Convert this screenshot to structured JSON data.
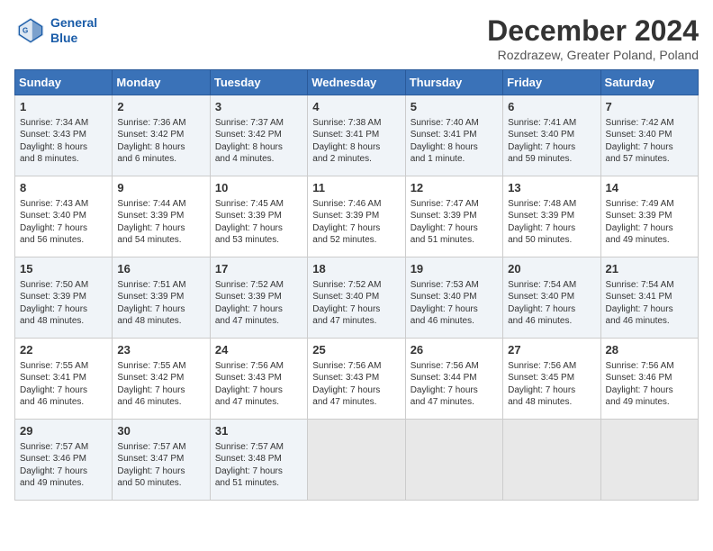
{
  "header": {
    "logo_line1": "General",
    "logo_line2": "Blue",
    "month_title": "December 2024",
    "location": "Rozdrazew, Greater Poland, Poland"
  },
  "weekdays": [
    "Sunday",
    "Monday",
    "Tuesday",
    "Wednesday",
    "Thursday",
    "Friday",
    "Saturday"
  ],
  "weeks": [
    [
      {
        "day": "1",
        "info": "Sunrise: 7:34 AM\nSunset: 3:43 PM\nDaylight: 8 hours\nand 8 minutes."
      },
      {
        "day": "2",
        "info": "Sunrise: 7:36 AM\nSunset: 3:42 PM\nDaylight: 8 hours\nand 6 minutes."
      },
      {
        "day": "3",
        "info": "Sunrise: 7:37 AM\nSunset: 3:42 PM\nDaylight: 8 hours\nand 4 minutes."
      },
      {
        "day": "4",
        "info": "Sunrise: 7:38 AM\nSunset: 3:41 PM\nDaylight: 8 hours\nand 2 minutes."
      },
      {
        "day": "5",
        "info": "Sunrise: 7:40 AM\nSunset: 3:41 PM\nDaylight: 8 hours\nand 1 minute."
      },
      {
        "day": "6",
        "info": "Sunrise: 7:41 AM\nSunset: 3:40 PM\nDaylight: 7 hours\nand 59 minutes."
      },
      {
        "day": "7",
        "info": "Sunrise: 7:42 AM\nSunset: 3:40 PM\nDaylight: 7 hours\nand 57 minutes."
      }
    ],
    [
      {
        "day": "8",
        "info": "Sunrise: 7:43 AM\nSunset: 3:40 PM\nDaylight: 7 hours\nand 56 minutes."
      },
      {
        "day": "9",
        "info": "Sunrise: 7:44 AM\nSunset: 3:39 PM\nDaylight: 7 hours\nand 54 minutes."
      },
      {
        "day": "10",
        "info": "Sunrise: 7:45 AM\nSunset: 3:39 PM\nDaylight: 7 hours\nand 53 minutes."
      },
      {
        "day": "11",
        "info": "Sunrise: 7:46 AM\nSunset: 3:39 PM\nDaylight: 7 hours\nand 52 minutes."
      },
      {
        "day": "12",
        "info": "Sunrise: 7:47 AM\nSunset: 3:39 PM\nDaylight: 7 hours\nand 51 minutes."
      },
      {
        "day": "13",
        "info": "Sunrise: 7:48 AM\nSunset: 3:39 PM\nDaylight: 7 hours\nand 50 minutes."
      },
      {
        "day": "14",
        "info": "Sunrise: 7:49 AM\nSunset: 3:39 PM\nDaylight: 7 hours\nand 49 minutes."
      }
    ],
    [
      {
        "day": "15",
        "info": "Sunrise: 7:50 AM\nSunset: 3:39 PM\nDaylight: 7 hours\nand 48 minutes."
      },
      {
        "day": "16",
        "info": "Sunrise: 7:51 AM\nSunset: 3:39 PM\nDaylight: 7 hours\nand 48 minutes."
      },
      {
        "day": "17",
        "info": "Sunrise: 7:52 AM\nSunset: 3:39 PM\nDaylight: 7 hours\nand 47 minutes."
      },
      {
        "day": "18",
        "info": "Sunrise: 7:52 AM\nSunset: 3:40 PM\nDaylight: 7 hours\nand 47 minutes."
      },
      {
        "day": "19",
        "info": "Sunrise: 7:53 AM\nSunset: 3:40 PM\nDaylight: 7 hours\nand 46 minutes."
      },
      {
        "day": "20",
        "info": "Sunrise: 7:54 AM\nSunset: 3:40 PM\nDaylight: 7 hours\nand 46 minutes."
      },
      {
        "day": "21",
        "info": "Sunrise: 7:54 AM\nSunset: 3:41 PM\nDaylight: 7 hours\nand 46 minutes."
      }
    ],
    [
      {
        "day": "22",
        "info": "Sunrise: 7:55 AM\nSunset: 3:41 PM\nDaylight: 7 hours\nand 46 minutes."
      },
      {
        "day": "23",
        "info": "Sunrise: 7:55 AM\nSunset: 3:42 PM\nDaylight: 7 hours\nand 46 minutes."
      },
      {
        "day": "24",
        "info": "Sunrise: 7:56 AM\nSunset: 3:43 PM\nDaylight: 7 hours\nand 47 minutes."
      },
      {
        "day": "25",
        "info": "Sunrise: 7:56 AM\nSunset: 3:43 PM\nDaylight: 7 hours\nand 47 minutes."
      },
      {
        "day": "26",
        "info": "Sunrise: 7:56 AM\nSunset: 3:44 PM\nDaylight: 7 hours\nand 47 minutes."
      },
      {
        "day": "27",
        "info": "Sunrise: 7:56 AM\nSunset: 3:45 PM\nDaylight: 7 hours\nand 48 minutes."
      },
      {
        "day": "28",
        "info": "Sunrise: 7:56 AM\nSunset: 3:46 PM\nDaylight: 7 hours\nand 49 minutes."
      }
    ],
    [
      {
        "day": "29",
        "info": "Sunrise: 7:57 AM\nSunset: 3:46 PM\nDaylight: 7 hours\nand 49 minutes."
      },
      {
        "day": "30",
        "info": "Sunrise: 7:57 AM\nSunset: 3:47 PM\nDaylight: 7 hours\nand 50 minutes."
      },
      {
        "day": "31",
        "info": "Sunrise: 7:57 AM\nSunset: 3:48 PM\nDaylight: 7 hours\nand 51 minutes."
      },
      null,
      null,
      null,
      null
    ]
  ]
}
